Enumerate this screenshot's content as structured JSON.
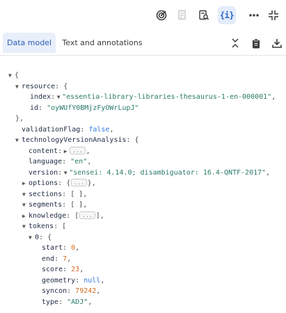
{
  "toolbar": {
    "buttons": [
      {
        "name": "target-icon"
      },
      {
        "name": "document-list-icon"
      },
      {
        "name": "document-search-icon"
      },
      {
        "name": "json-view-icon",
        "label": "{i}",
        "active": true
      },
      {
        "name": "more-icon"
      },
      {
        "name": "collapse-panel-icon"
      }
    ]
  },
  "tabs": [
    {
      "label": "Data model",
      "active": true
    },
    {
      "label": "Text and annotations",
      "active": false
    }
  ],
  "tab_actions": [
    "collapse-all-icon",
    "clipboard-icon",
    "download-icon"
  ],
  "tree": {
    "open_brace": "{",
    "resource_key": "resource",
    "index_key": "index",
    "index_value": "\"essentia-library-libraries-thesaurus-1-en-000001\"",
    "id_key": "id",
    "id_value": "\"oyWUfY0BMjzFyOWrLupJ\"",
    "close_resource": "},",
    "validation_key": "validationFlag",
    "validation_value": "false",
    "tva_key": "technologyVersionAnalysis",
    "content_key": "content",
    "ellipsis": "...",
    "language_key": "language",
    "language_value": "\"en\"",
    "version_key": "version",
    "version_value": "\"sensei: 4.14.0; disambiguator: 16.4-QNTF-2017\"",
    "options_key": "options",
    "sections_key": "sections",
    "segments_key": "segments",
    "knowledge_key": "knowledge",
    "tokens_key": "tokens",
    "token_index": "0",
    "start_key": "start",
    "start_value": "0",
    "end_key": "end",
    "end_value": "7",
    "score_key": "score",
    "score_value": "23",
    "geometry_key": "geometry",
    "geometry_value": "null",
    "syncon_key": "syncon",
    "syncon_value": "79242",
    "type_key": "type",
    "type_value": "\"ADJ\""
  }
}
